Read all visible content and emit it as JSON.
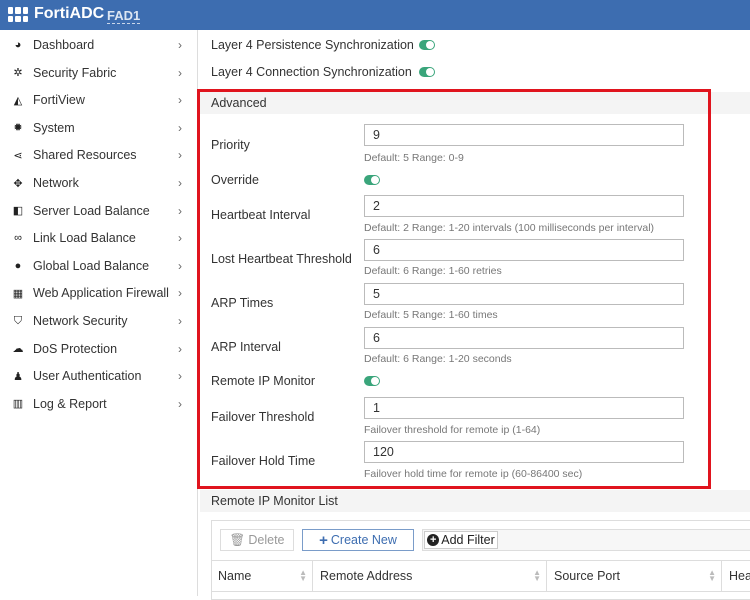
{
  "header": {
    "brand": "FortiADC",
    "hostname": "FAD1"
  },
  "sidebar": {
    "items": [
      {
        "label": "Dashboard",
        "icon": "dashboard-icon",
        "glyph": "◕"
      },
      {
        "label": "Security Fabric",
        "icon": "security-fabric-icon",
        "glyph": "✲"
      },
      {
        "label": "FortiView",
        "icon": "fortiview-icon",
        "glyph": "◭"
      },
      {
        "label": "System",
        "icon": "gear-icon",
        "glyph": "✹"
      },
      {
        "label": "Shared Resources",
        "icon": "share-icon",
        "glyph": "⋖"
      },
      {
        "label": "Network",
        "icon": "network-icon",
        "glyph": "✥"
      },
      {
        "label": "Server Load Balance",
        "icon": "server-load-balance-icon",
        "glyph": "◧"
      },
      {
        "label": "Link Load Balance",
        "icon": "link-icon",
        "glyph": "∞"
      },
      {
        "label": "Global Load Balance",
        "icon": "globe-icon",
        "glyph": "●"
      },
      {
        "label": "Web Application Firewall",
        "icon": "firewall-icon",
        "glyph": "▦"
      },
      {
        "label": "Network Security",
        "icon": "shield-icon",
        "glyph": "⛉"
      },
      {
        "label": "DoS Protection",
        "icon": "cloud-icon",
        "glyph": "☁"
      },
      {
        "label": "User Authentication",
        "icon": "user-icon",
        "glyph": "♟"
      },
      {
        "label": "Log & Report",
        "icon": "chart-icon",
        "glyph": "▥"
      }
    ],
    "chevron": "›"
  },
  "sync": {
    "l4_persistence": "Layer 4 Persistence Synchronization",
    "l4_connection": "Layer 4 Connection Synchronization"
  },
  "advanced": {
    "title": "Advanced",
    "priority": {
      "label": "Priority",
      "value": "9",
      "hint": "Default: 5 Range: 0-9"
    },
    "override": {
      "label": "Override"
    },
    "heartbeat_interval": {
      "label": "Heartbeat Interval",
      "value": "2",
      "hint": "Default: 2 Range: 1-20 intervals (100 milliseconds per interval)"
    },
    "lost_heartbeat": {
      "label": "Lost Heartbeat Threshold",
      "value": "6",
      "hint": "Default: 6 Range: 1-60 retries"
    },
    "arp_times": {
      "label": "ARP Times",
      "value": "5",
      "hint": "Default: 5 Range: 1-60 times"
    },
    "arp_interval": {
      "label": "ARP Interval",
      "value": "6",
      "hint": "Default: 6 Range: 1-20 seconds"
    },
    "remote_ip_monitor": {
      "label": "Remote IP Monitor"
    },
    "failover_threshold": {
      "label": "Failover Threshold",
      "value": "1",
      "hint": "Failover threshold for remote ip (1-64)"
    },
    "failover_hold": {
      "label": "Failover Hold Time",
      "value": "120",
      "hint": "Failover hold time for remote ip (60-86400 sec)"
    }
  },
  "monitor_list": {
    "title": "Remote IP Monitor List",
    "delete": "Delete",
    "create": "Create New",
    "add_filter": "Add Filter",
    "columns": [
      "Name",
      "Remote Address",
      "Source Port",
      "Hea"
    ]
  },
  "colors": {
    "header": "#3d6db0",
    "toggle": "#3aa57b",
    "highlight": "#e0141e",
    "accent": "#3d6db0"
  }
}
